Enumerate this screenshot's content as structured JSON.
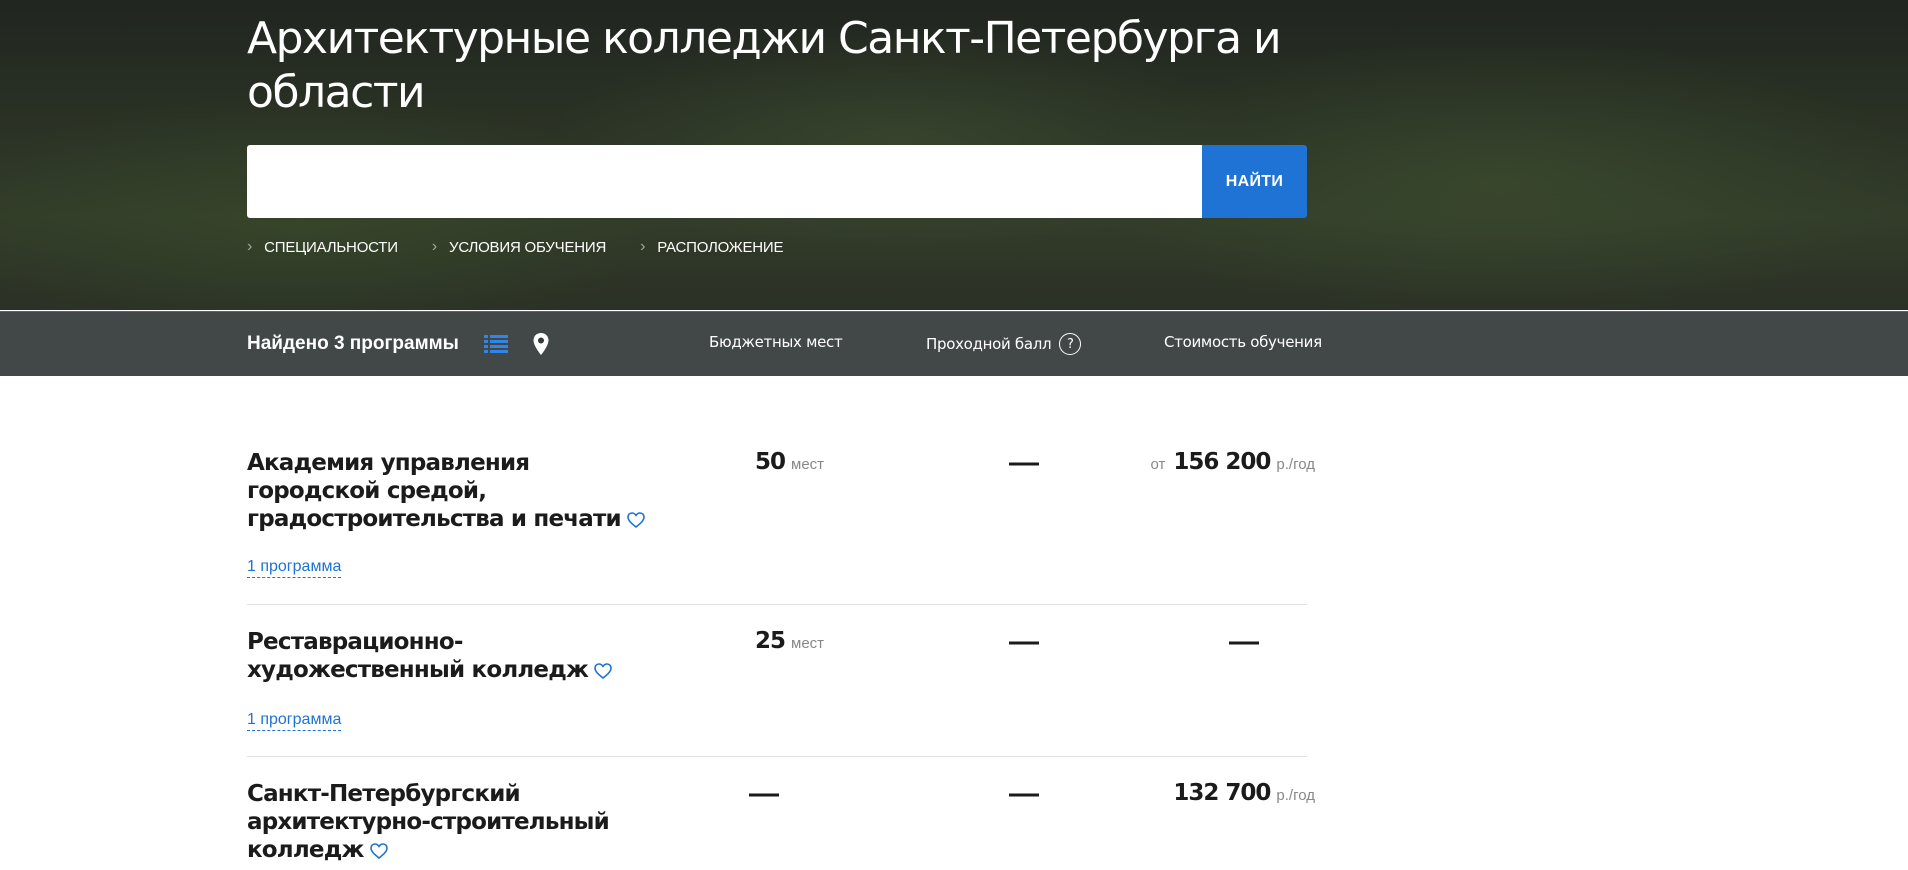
{
  "page": {
    "title": "Архитектурные колледжи Санкт-Петербурга и области"
  },
  "search": {
    "placeholder": "",
    "button_label": "НАЙТИ"
  },
  "filters": [
    {
      "label": "СПЕЦИАЛЬНОСТИ"
    },
    {
      "label": "УСЛОВИЯ ОБУЧЕНИЯ"
    },
    {
      "label": "РАСПОЛОЖЕНИЕ"
    }
  ],
  "results_bar": {
    "count_text": "Найдено 3 программы",
    "columns": {
      "budget": "Бюджетных мест",
      "score": "Проходной балл",
      "score_help": "?",
      "cost": "Стоимость обучения"
    }
  },
  "units": {
    "places": "мест",
    "per_year": "р./год",
    "from": "от",
    "dash": "—"
  },
  "colleges": [
    {
      "name": "Академия управления городской средой, градостроительства и печати",
      "programs": "1 программа",
      "budget_places": "50",
      "cost": "156 200"
    },
    {
      "name": "Реставрационно-художественный колледж",
      "programs": "1 программа",
      "budget_places": "25"
    },
    {
      "name": "Санкт-Петербургский архитектурно-строительный колледж",
      "cost": "132 700"
    }
  ],
  "colors": {
    "accent": "#1e73d4",
    "text": "#1b1b1b",
    "muted": "#888888"
  },
  "icons": {
    "list_view": "list-icon",
    "map_view": "map-pin-icon",
    "favorite": "heart-outline-icon",
    "filter_chevron": "chevron-right-icon"
  }
}
